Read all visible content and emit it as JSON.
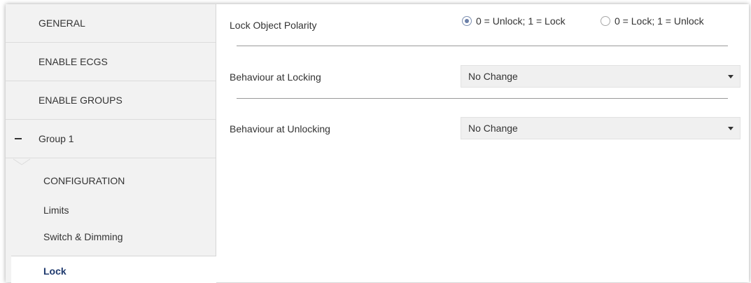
{
  "sidebar": {
    "items": [
      {
        "label": "GENERAL"
      },
      {
        "label": "ENABLE ECGS"
      },
      {
        "label": "ENABLE GROUPS"
      },
      {
        "label": "Group 1"
      }
    ],
    "sub_items": [
      {
        "label": "CONFIGURATION"
      },
      {
        "label": "Limits"
      },
      {
        "label": "Switch & Dimming"
      },
      {
        "label": "Lock"
      }
    ]
  },
  "main": {
    "polarity": {
      "label": "Lock Object Polarity",
      "options": [
        {
          "label": "0 = Unlock; 1 = Lock",
          "checked": true
        },
        {
          "label": "0 = Lock; 1 = Unlock",
          "checked": false
        }
      ]
    },
    "locking": {
      "label": "Behaviour at Locking",
      "value": "No Change"
    },
    "unlocking": {
      "label": "Behaviour at Unlocking",
      "value": "No Change"
    }
  },
  "colors": {
    "sidebar_bg": "#f2f2f2",
    "active_text": "#1f3a6e",
    "select_bg": "#f0f0f0"
  }
}
